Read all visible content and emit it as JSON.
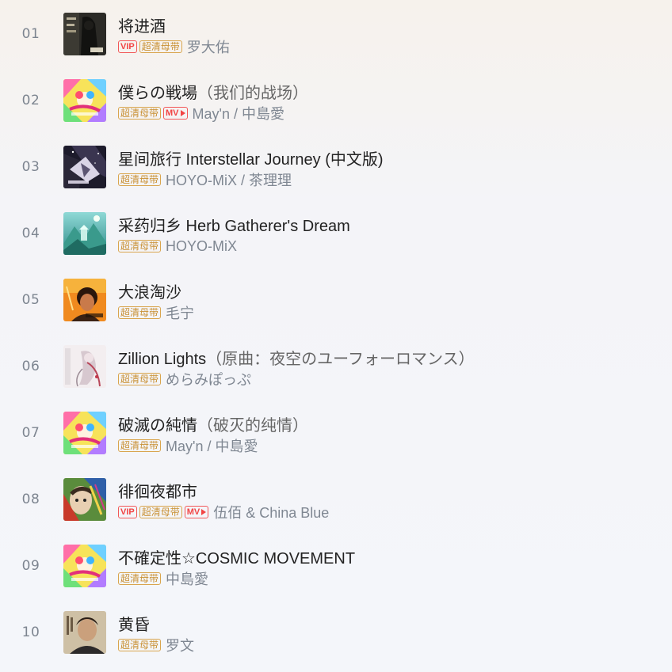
{
  "tracks": [
    {
      "rank": "01",
      "title": "将进酒",
      "subtitle": "",
      "vip": "VIP",
      "hq": "超清母带",
      "mv": "",
      "artist": "罗大佑",
      "cover_icon": "album-cover-dark-calligraphy"
    },
    {
      "rank": "02",
      "title": "僕らの戦場",
      "subtitle": "（我们的战场）",
      "vip": "",
      "hq": "超清母带",
      "mv": "MV",
      "artist": "May'n / 中島愛",
      "cover_icon": "album-cover-colorful-anime"
    },
    {
      "rank": "03",
      "title": "星间旅行 Interstellar Journey (中文版)",
      "subtitle": "",
      "vip": "",
      "hq": "超清母带",
      "mv": "",
      "artist": "HOYO-MiX / 茶理理",
      "cover_icon": "album-cover-starry-night"
    },
    {
      "rank": "04",
      "title": "采药归乡 Herb Gatherer's Dream",
      "subtitle": "",
      "vip": "",
      "hq": "超清母带",
      "mv": "",
      "artist": "HOYO-MiX",
      "cover_icon": "album-cover-mountain-landscape"
    },
    {
      "rank": "05",
      "title": "大浪淘沙",
      "subtitle": "",
      "vip": "",
      "hq": "超清母带",
      "mv": "",
      "artist": "毛宁",
      "cover_icon": "album-cover-orange-portrait"
    },
    {
      "rank": "06",
      "title": "Zillion Lights",
      "subtitle": "（原曲：夜空のユーフォーロマンス）",
      "vip": "",
      "hq": "超清母带",
      "mv": "",
      "artist": "めらみぽっぷ",
      "cover_icon": "album-cover-white-illustration"
    },
    {
      "rank": "07",
      "title": "破滅の純情",
      "subtitle": "（破灭的纯情）",
      "vip": "",
      "hq": "超清母带",
      "mv": "",
      "artist": "May'n / 中島愛",
      "cover_icon": "album-cover-colorful-anime"
    },
    {
      "rank": "08",
      "title": "徘徊夜都市",
      "subtitle": "",
      "vip": "VIP",
      "hq": "超清母带",
      "mv": "MV",
      "artist": "伍佰 & China Blue",
      "cover_icon": "album-cover-painted-face"
    },
    {
      "rank": "09",
      "title": "不確定性☆COSMIC MOVEMENT",
      "subtitle": "",
      "vip": "",
      "hq": "超清母带",
      "mv": "",
      "artist": "中島愛",
      "cover_icon": "album-cover-colorful-anime"
    },
    {
      "rank": "10",
      "title": "黄昏",
      "subtitle": "",
      "vip": "",
      "hq": "超清母带",
      "mv": "",
      "artist": "罗文",
      "cover_icon": "album-cover-vintage-portrait"
    }
  ],
  "colors": {
    "vip": "#f24545",
    "hq": "#c99033",
    "title": "#222222",
    "artist": "#7f8792",
    "rank": "#7d8590"
  }
}
